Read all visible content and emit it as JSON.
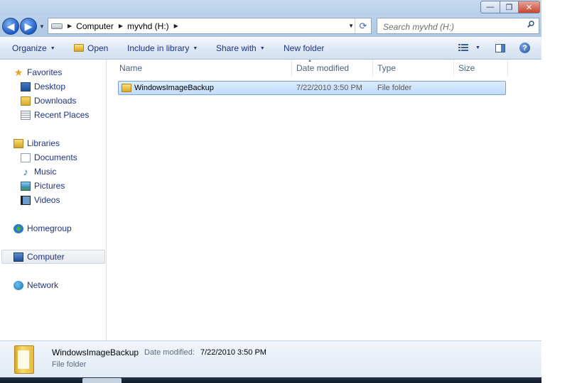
{
  "window": {
    "caption": {
      "minimize": "—",
      "maximize": "❐",
      "close": "✕"
    }
  },
  "nav": {
    "back": "◀",
    "forward": "▶"
  },
  "address": {
    "breadcrumbs": [
      "Computer",
      "myvhd (H:)"
    ]
  },
  "search": {
    "placeholder": "Search myvhd (H:)"
  },
  "toolbar": {
    "organize": "Organize",
    "open": "Open",
    "include_in_library": "Include in library",
    "share_with": "Share with",
    "new_folder": "New folder"
  },
  "sidebar": {
    "favorites": {
      "label": "Favorites",
      "items": [
        "Desktop",
        "Downloads",
        "Recent Places"
      ]
    },
    "libraries": {
      "label": "Libraries",
      "items": [
        "Documents",
        "Music",
        "Pictures",
        "Videos"
      ]
    },
    "homegroup": "Homegroup",
    "computer": "Computer",
    "network": "Network"
  },
  "filelist": {
    "columns": [
      "Name",
      "Date modified",
      "Type",
      "Size"
    ],
    "rows": [
      {
        "name": "WindowsImageBackup",
        "date_modified": "7/22/2010 3:50 PM",
        "type": "File folder",
        "size": ""
      }
    ]
  },
  "details": {
    "name": "WindowsImageBackup",
    "date_label": "Date modified:",
    "date_value": "7/22/2010 3:50 PM",
    "type": "File folder"
  },
  "colors": {
    "accent": "#1e3287",
    "selection": "#c1dcfc"
  }
}
